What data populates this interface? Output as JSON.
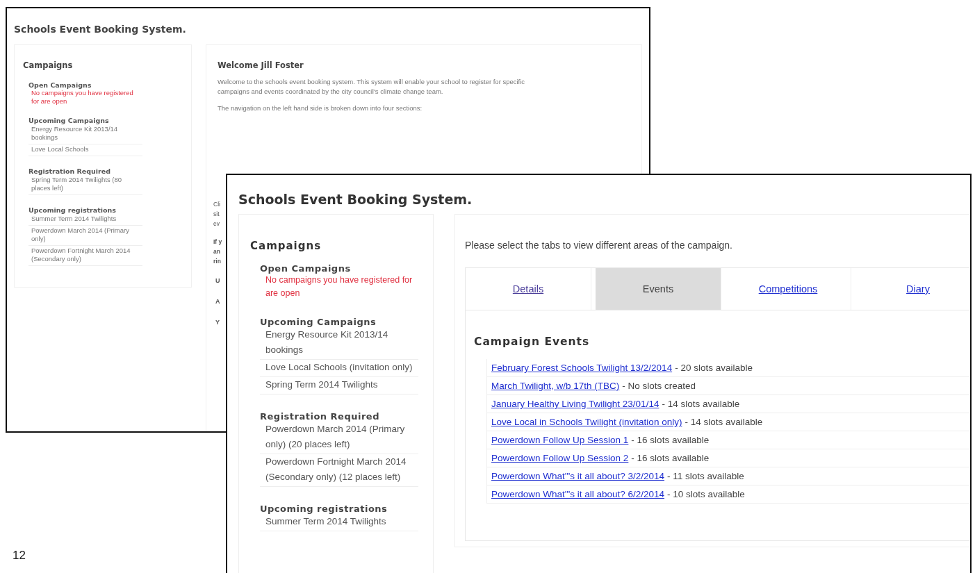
{
  "page_number": "12",
  "back_window": {
    "title": "Schools Event Booking System.",
    "sidebar": {
      "heading": "Campaigns",
      "sections": [
        {
          "heading": "Open Campaigns",
          "notice": "No campaigns you have registered for are open"
        },
        {
          "heading": "Upcoming Campaigns",
          "items": [
            "Energy Resource Kit 2013/14 bookings",
            "Love Local Schools"
          ]
        },
        {
          "heading": "Registration Required",
          "items": [
            "Spring Term 2014 Twilights (80 places left)"
          ]
        },
        {
          "heading": "Upcoming registrations",
          "items": [
            "Summer Term 2014 Twilights",
            "Powerdown March 2014 (Primary only)",
            "Powerdown Fortnight March 2014 (Secondary only)"
          ]
        }
      ]
    },
    "main": {
      "heading": "Welcome Jill Foster",
      "paragraphs": [
        "Welcome to the schools event booking system. This system will enable your school to register for specific campaigns and events coordinated by the city council's climate change team.",
        "The navigation on the left hand side is broken down into four sections:"
      ],
      "cut_paragraphs": [
        [
          "Cli",
          "sit",
          "ev"
        ],
        [
          "If y",
          "an",
          "rin"
        ]
      ],
      "cut_items": [
        "U",
        "A",
        "Y"
      ]
    }
  },
  "front_window": {
    "title": "Schools Event Booking System.",
    "sidebar": {
      "heading": "Campaigns",
      "sections": [
        {
          "heading": "Open Campaigns",
          "notice": "No campaigns you have registered for are open"
        },
        {
          "heading": "Upcoming Campaigns",
          "items": [
            "Energy Resource Kit 2013/14 bookings",
            "Love Local Schools (invitation only)",
            "Spring Term 2014 Twilights"
          ]
        },
        {
          "heading": "Registration Required",
          "items": [
            "Powerdown March 2014 (Primary only) (20 places left)",
            "Powerdown Fortnight March 2014 (Secondary only) (12 places left)"
          ]
        },
        {
          "heading": "Upcoming registrations",
          "items": [
            "Summer Term 2014 Twilights"
          ]
        }
      ]
    },
    "intro": "Please select the tabs to view different areas of the campaign.",
    "tabs": [
      {
        "label": "Details",
        "selected": false,
        "visited": true
      },
      {
        "label": "Events",
        "selected": true,
        "visited": false
      },
      {
        "label": "Competitions",
        "selected": false,
        "visited": false
      },
      {
        "label": "Diary",
        "selected": false,
        "visited": false
      }
    ],
    "events_heading": "Campaign Events",
    "events": [
      {
        "link": "February Forest Schools Twilight 13/2/2014",
        "status": "- 20 slots available"
      },
      {
        "link": "March Twilight, w/b 17th (TBC)",
        "status": "- No slots created"
      },
      {
        "link": "January Healthy Living Twilight 23/01/14",
        "status": "- 14 slots available"
      },
      {
        "link": "Love Local in Schools Twilight (invitation only)",
        "status": "- 14 slots available"
      },
      {
        "link": "Powerdown Follow Up Session 1",
        "status": "- 16 slots available"
      },
      {
        "link": "Powerdown Follow Up Session 2",
        "status": "- 16 slots available"
      },
      {
        "link": "Powerdown What'\"s it all about? 3/2/2014",
        "status": "- 11 slots available"
      },
      {
        "link": "Powerdown What'\"s it all about? 6/2/2014",
        "status": "- 10 slots available"
      }
    ]
  }
}
